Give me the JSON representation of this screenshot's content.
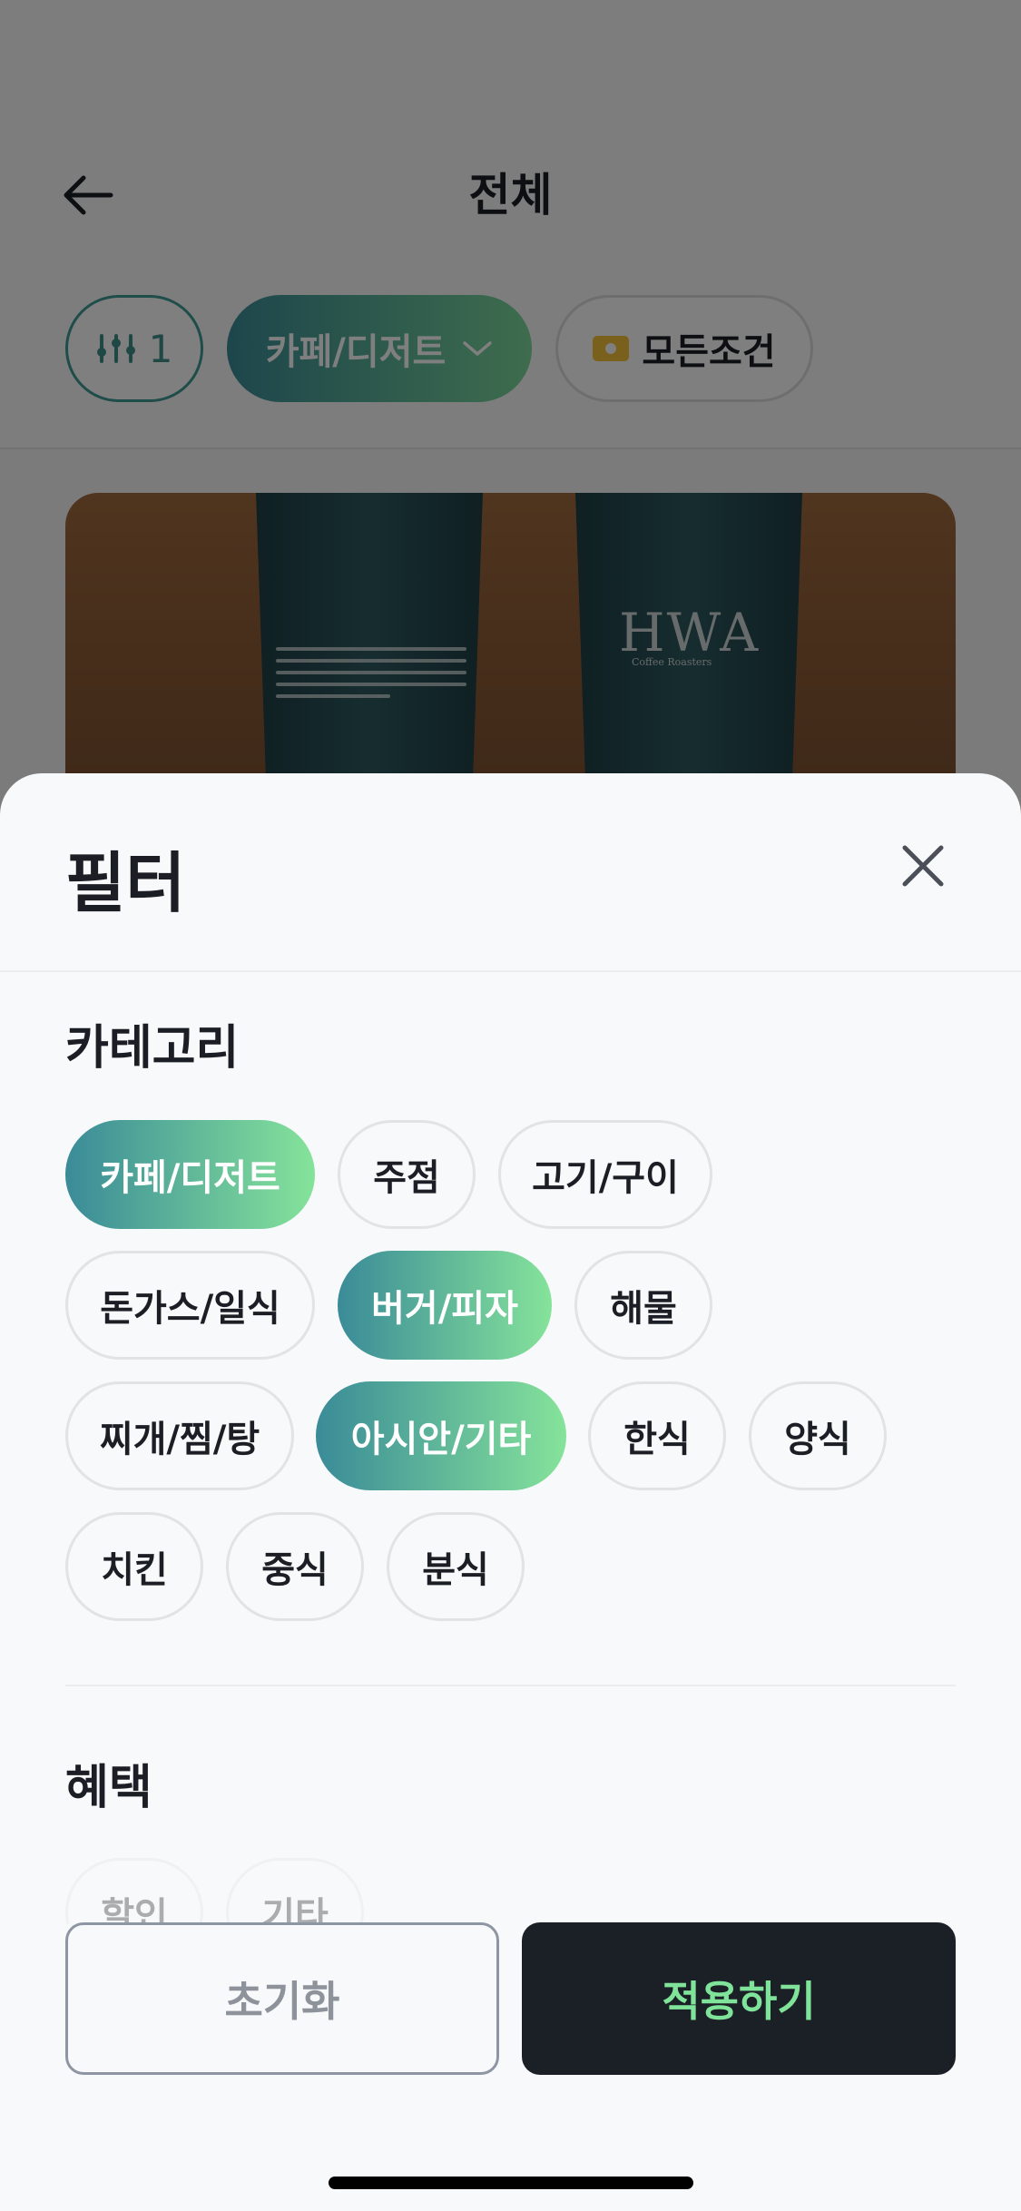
{
  "header": {
    "title": "전체"
  },
  "top_chips": {
    "filter_count": "1",
    "category_label": "카페/디저트",
    "all_conditions_label": "모든조건"
  },
  "image": {
    "brand": "HWA",
    "brand_sub": "Coffee Roasters"
  },
  "sheet": {
    "title": "필터",
    "category_section": "카테고리",
    "categories": [
      {
        "label": "카페/디저트",
        "selected": true
      },
      {
        "label": "주점",
        "selected": false
      },
      {
        "label": "고기/구이",
        "selected": false
      },
      {
        "label": "돈가스/일식",
        "selected": false
      },
      {
        "label": "버거/피자",
        "selected": true
      },
      {
        "label": "해물",
        "selected": false
      },
      {
        "label": "찌개/찜/탕",
        "selected": false
      },
      {
        "label": "아시안/기타",
        "selected": true
      },
      {
        "label": "한식",
        "selected": false
      },
      {
        "label": "양식",
        "selected": false
      },
      {
        "label": "치킨",
        "selected": false
      },
      {
        "label": "중식",
        "selected": false
      },
      {
        "label": "분식",
        "selected": false
      }
    ],
    "benefit_section": "혜택",
    "benefits": [
      {
        "label": "할인"
      },
      {
        "label": "기타"
      }
    ],
    "reset_label": "초기화",
    "apply_label": "적용하기"
  },
  "colors": {
    "accent_gradient_start": "#3a8b98",
    "accent_gradient_end": "#85e39a",
    "apply_text": "#7fe49a",
    "dark": "#1b1f26"
  }
}
